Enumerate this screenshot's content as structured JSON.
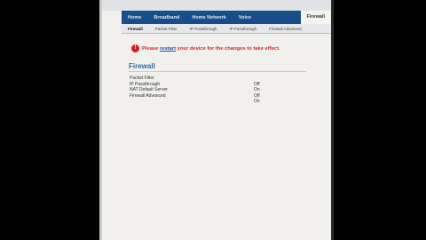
{
  "main_tabs": [
    "Home",
    "Broadband",
    "Home Network",
    "Voice",
    "Firewall"
  ],
  "sub_tabs": [
    "Firewall",
    "Packet Filter",
    "IP Passthrough",
    "IP Passthrough",
    "Firewall Advanced"
  ],
  "notice": {
    "prefix": "Please ",
    "link": "restart",
    "suffix": " your device for the changes to take effect."
  },
  "section_title": "Firewall",
  "settings": [
    {
      "label": "Packet Filter",
      "value": ""
    },
    {
      "label": "IP Passthrough",
      "value": "Off"
    },
    {
      "label": "NAT Default Server",
      "value": "On"
    },
    {
      "label": "Firewall Advanced",
      "value": "Off"
    },
    {
      "label": "",
      "value": "On"
    }
  ],
  "colors": {
    "tab_bar": "#174d8a",
    "notice": "#d12a2a",
    "title": "#2d6a9f"
  }
}
